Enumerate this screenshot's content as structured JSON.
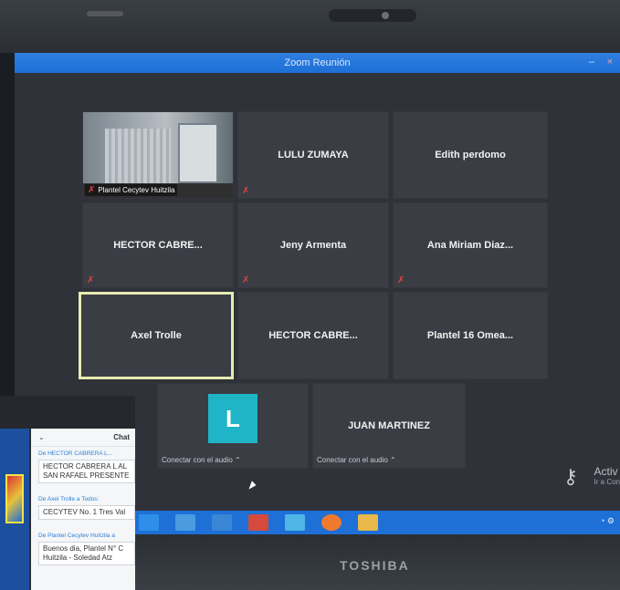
{
  "window": {
    "title": "Zoom Reunión",
    "minimize": "–",
    "close": "×"
  },
  "tiles": [
    {
      "id": "plantel-cecytev-huitzila",
      "name": "Plantel Cecytev Huitzila",
      "muted": true,
      "video": true
    },
    {
      "id": "lulu-zumaya",
      "name": "LULU ZUMAYA",
      "muted": true
    },
    {
      "id": "edith-perdomo",
      "name": "Edith perdomo",
      "muted": false
    },
    {
      "id": "hector-cabre-1",
      "name": "HECTOR CABRE...",
      "muted": true
    },
    {
      "id": "jeny-armenta",
      "name": "Jeny Armenta",
      "muted": true
    },
    {
      "id": "ana-miriam-diaz",
      "name": "Ana Miriam Diaz...",
      "muted": true
    },
    {
      "id": "axel-trolle",
      "name": "Axel Trolle",
      "muted": false,
      "active": true
    },
    {
      "id": "hector-cabre-2",
      "name": "HECTOR CABRE...",
      "muted": false
    },
    {
      "id": "plantel-16-omea",
      "name": "Plantel 16 Omea...",
      "muted": false
    },
    {
      "id": "avatar-l",
      "name": "",
      "avatar": "L",
      "audio": "Conectar con el audio ⌃"
    },
    {
      "id": "juan-martinez",
      "name": "JUAN MARTINEZ",
      "audio": "Conectar con el audio ⌃"
    }
  ],
  "mute_icon": "✗",
  "activate_windows": {
    "line1": "Activ",
    "line2": "Ir a Con"
  },
  "key_icon": "⚷",
  "taskbar": {
    "tray": "◔ ⚙"
  },
  "laptop": {
    "brand": "TOSHIBA"
  },
  "chat": {
    "title": "Chat",
    "chevron": "⌄",
    "messages": [
      {
        "from": "De HECTOR CABRERA L...",
        "lines": [
          "HECTOR CABRERA L AL",
          "SAN RAFAEL PRESENTE"
        ]
      },
      {
        "from": "De Axel Trolle a Todos:",
        "lines": [
          "CECYTEV No. 1 Tres Val"
        ]
      },
      {
        "from": "De Plantel Cecytev Huitzila a",
        "lines": [
          "Buenos dia, Plantel N° C",
          "Huitzila - Soledad Atz"
        ]
      }
    ]
  },
  "colors": {
    "titlebar": "#1e6fd6",
    "tile": "#3a3d44",
    "avatar": "#1fb5c6",
    "active_border": "#e7ecb1",
    "mute": "#e0443e"
  }
}
